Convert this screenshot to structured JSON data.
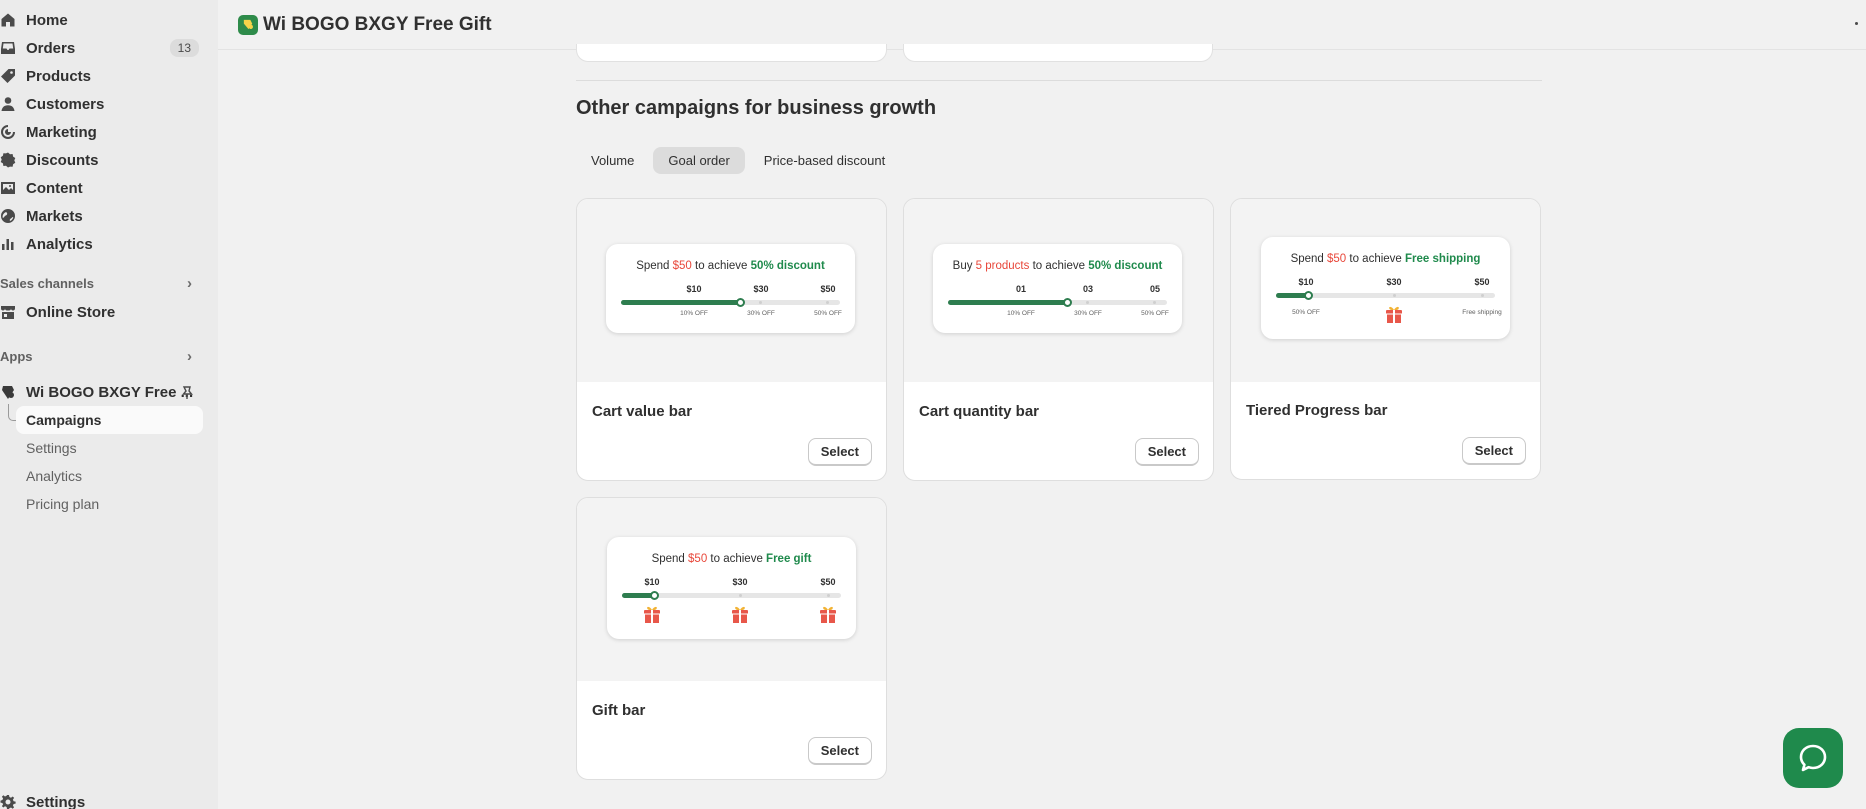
{
  "sidebar": {
    "nav": [
      {
        "label": "Home",
        "icon": "home-icon"
      },
      {
        "label": "Orders",
        "icon": "inbox-icon",
        "badge": "13"
      },
      {
        "label": "Products",
        "icon": "tag-icon"
      },
      {
        "label": "Customers",
        "icon": "person-icon"
      },
      {
        "label": "Marketing",
        "icon": "target-icon"
      },
      {
        "label": "Discounts",
        "icon": "discount-icon"
      },
      {
        "label": "Content",
        "icon": "image-icon"
      },
      {
        "label": "Markets",
        "icon": "globe-icon"
      },
      {
        "label": "Analytics",
        "icon": "bar-chart-icon"
      }
    ],
    "sales_channels": {
      "heading": "Sales channels",
      "items": [
        {
          "label": "Online Store",
          "icon": "store-icon"
        }
      ]
    },
    "apps": {
      "heading": "Apps",
      "app_name": "Wi BOGO BXGY Free ...",
      "sub_items": [
        "Campaigns",
        "Settings",
        "Analytics",
        "Pricing plan"
      ]
    },
    "settings_label": "Settings"
  },
  "topbar": {
    "title": "Wi BOGO BXGY Free Gift"
  },
  "main": {
    "section_title": "Other campaigns for business growth",
    "tabs": [
      {
        "label": "Volume",
        "active": false
      },
      {
        "label": "Goal order",
        "active": true
      },
      {
        "label": "Price-based discount",
        "active": false
      }
    ],
    "cards": [
      {
        "name": "Cart value bar",
        "button": "Select",
        "preview": {
          "pre": "Spend ",
          "highlight": "$50",
          "mid": " to achieve ",
          "goal": "50% discount",
          "labels": [
            "$10",
            "$30",
            "$50"
          ],
          "sub_labels": [
            "10% OFF",
            "30% OFF",
            "50% OFF"
          ],
          "progress": 0.55
        }
      },
      {
        "name": "Cart quantity bar",
        "button": "Select",
        "preview": {
          "pre": "Buy ",
          "highlight": "5 products",
          "mid": " to achieve ",
          "goal": "50% discount",
          "labels": [
            "01",
            "03",
            "05"
          ],
          "sub_labels": [
            "10% OFF",
            "30% OFF",
            "50% OFF"
          ],
          "progress": 0.55
        }
      },
      {
        "name": "Tiered Progress bar",
        "button": "Select",
        "preview": {
          "pre": "Spend ",
          "highlight": "$50",
          "mid": " to achieve ",
          "goal": "Free shipping",
          "labels": [
            "$10",
            "$30",
            "$50"
          ],
          "sub_labels": [
            "50% OFF",
            "Free shipping"
          ],
          "progress": 0.15
        }
      },
      {
        "name": "Gift bar",
        "button": "Select",
        "preview": {
          "pre": "Spend ",
          "highlight": "$50",
          "mid": " to achieve ",
          "goal": "Free gift",
          "labels": [
            "$10",
            "$30",
            "$50"
          ],
          "progress": 0.15
        }
      }
    ]
  },
  "colors": {
    "accent": "#2e7d4f",
    "highlight_red": "#e8473a",
    "gift_red": "#e8574a",
    "gift_yellow": "#f2b233"
  }
}
